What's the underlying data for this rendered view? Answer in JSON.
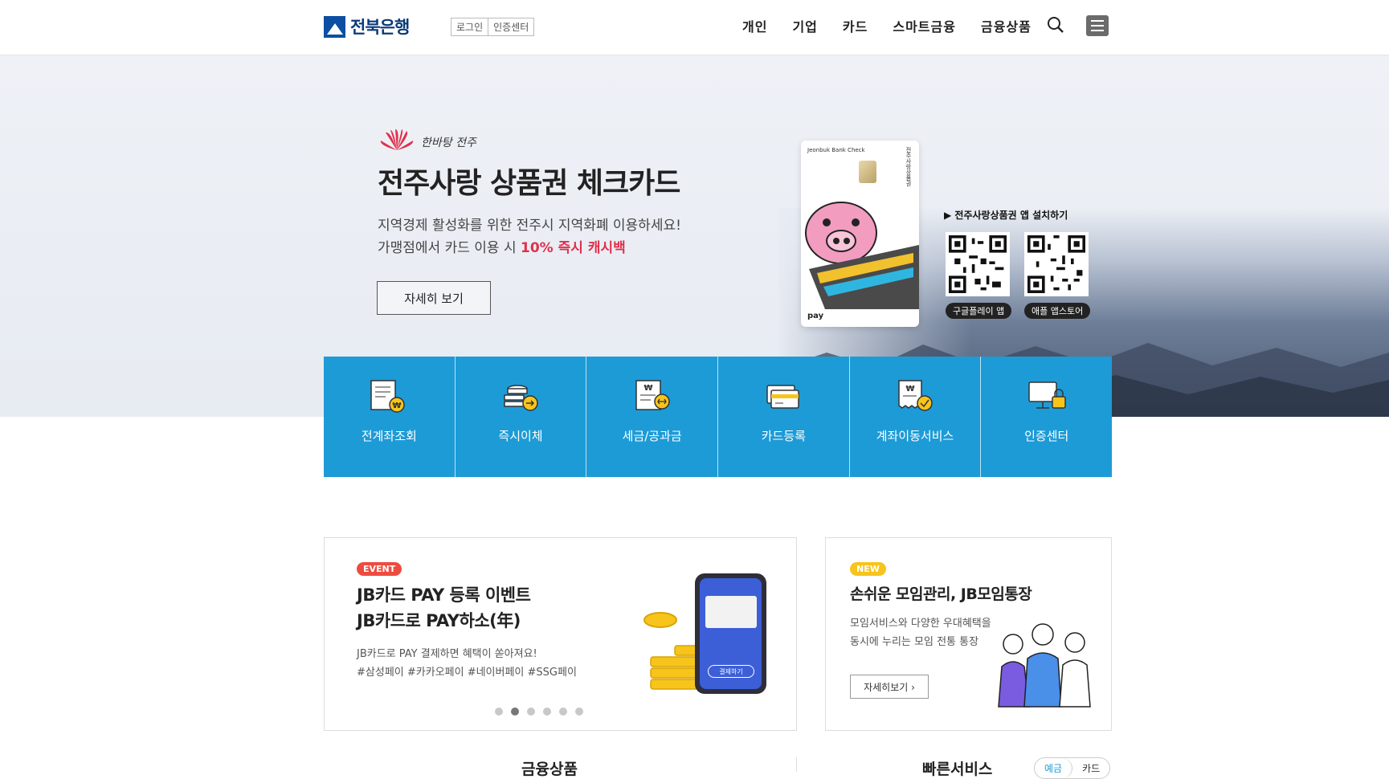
{
  "header": {
    "logo_text": "전북은행",
    "util": [
      "로그인",
      "인증센터"
    ],
    "nav": [
      "개인",
      "기업",
      "카드",
      "스마트금융",
      "금융상품"
    ]
  },
  "hero": {
    "slogan": "한바탕 전주",
    "title": "전주사랑 상품권 체크카드",
    "desc_line1": "지역경제 활성화를 위한 전주시 지역화폐 이용하세요!",
    "desc_line2_pre": "가맹점에서 카드 이용 시 ",
    "desc_line2_hl": "10% 즉시 캐시백",
    "button": "자세히 보기",
    "card_brand": "Jeonbuk Bank Check",
    "card_vertical": "전주사랑상품권",
    "card_pay": "pay",
    "qr_title": "▶ 전주사랑상품권 앱 설치하기",
    "qr_labels": [
      "구글플레이 앱",
      "애플 앱스토어"
    ]
  },
  "quick": [
    {
      "label": "전계좌조회",
      "icon": "account-inquiry-icon"
    },
    {
      "label": "즉시이체",
      "icon": "instant-transfer-icon"
    },
    {
      "label": "세금/공과금",
      "icon": "tax-bill-icon"
    },
    {
      "label": "카드등록",
      "icon": "card-register-icon"
    },
    {
      "label": "계좌이동서비스",
      "icon": "account-switch-icon"
    },
    {
      "label": "인증센터",
      "icon": "certificate-center-icon"
    }
  ],
  "promo_event": {
    "badge": "EVENT",
    "title_line1": "JB카드 PAY 등록 이벤트",
    "title_line2": "JB카드로 PAY하소(年)",
    "desc_line1": "JB카드로 PAY 결제하면 혜택이 쏟아져요!",
    "desc_line2": "#삼성페이 #카카오페이 #네이버페이 #SSG페이",
    "phone_button": "결제하기",
    "slide_count": 6,
    "active_slide": 2
  },
  "promo_new": {
    "badge": "NEW",
    "title": "손쉬운 모임관리, JB모임통장",
    "desc_line1": "모임서비스와 다양한 우대혜택을",
    "desc_line2": "동시에 누리는 모임 전통 통장",
    "button": "자세히보기 ›"
  },
  "bottom": {
    "left_title": "금융상품",
    "right_title": "빠른서비스",
    "toggle": [
      "예금",
      "카드"
    ]
  },
  "colors": {
    "accent": "#1d9bd7",
    "brand": "#0b4ea2",
    "highlight": "#e0304c",
    "event": "#ee4b3f",
    "new": "#f7c41c"
  }
}
